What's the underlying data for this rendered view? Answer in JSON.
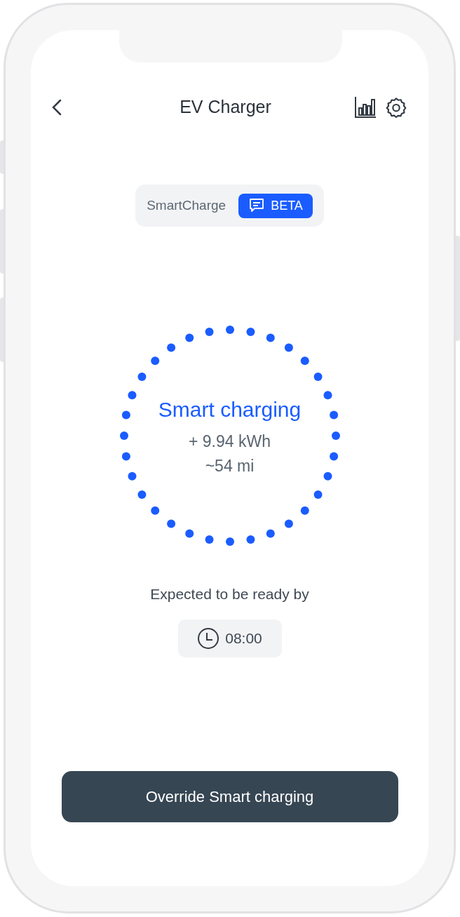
{
  "header": {
    "title": "EV Charger"
  },
  "mode_chip": {
    "label": "SmartCharge",
    "badge": "BETA"
  },
  "status": {
    "title": "Smart charging",
    "energy": "+ 9.94 kWh",
    "range": "~54 mi"
  },
  "ready": {
    "label": "Expected to be ready by",
    "time": "08:00"
  },
  "action_button": {
    "label": "Override Smart charging"
  }
}
